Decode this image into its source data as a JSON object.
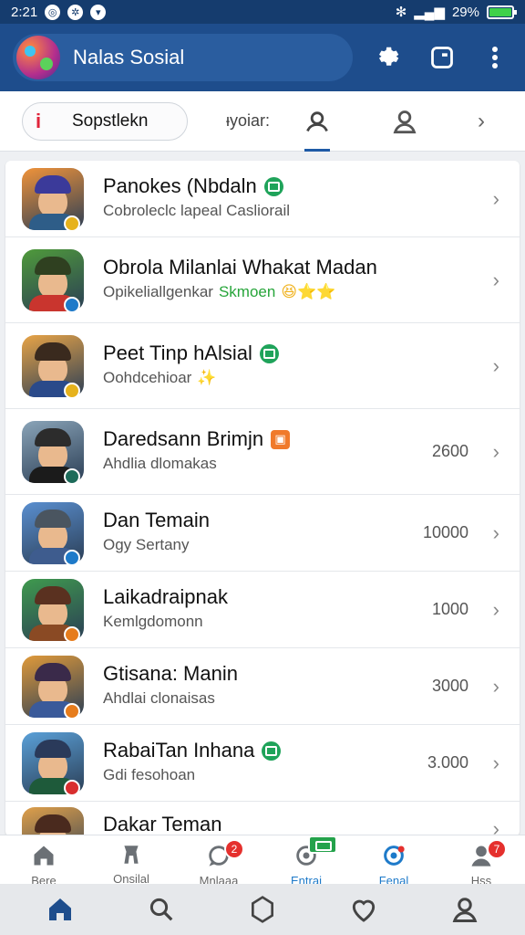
{
  "status_bar": {
    "time": "2:21",
    "left_icons": [
      "app-icon",
      "pinwheel-icon",
      "shield-icon"
    ],
    "battery": "29%"
  },
  "header": {
    "title": "Nalas Sosial",
    "icons": [
      "gear-icon",
      "square-icon",
      "more-icon"
    ]
  },
  "tabs": {
    "search_mark": "i",
    "search_label": "Sopstlekn",
    "text_tab": "ᵻyoiar:",
    "icons": [
      "person-icon",
      "person-icon"
    ]
  },
  "list": [
    {
      "title": "Panokes (Nbdaln",
      "subtitle": "Cobroleclc lapeal Casliorail",
      "count": "",
      "verified": true,
      "tag": false,
      "badge_color": "#e6b21c",
      "hat": "#3b3a9a",
      "body": "#2e5d88",
      "bg": "#f0933a"
    },
    {
      "title": "Obrola Milanlai Whakat Madan",
      "subtitle": "Opikeliallgenkar",
      "subtitle_green": "Skmoen",
      "emoji": "😆⭐⭐",
      "count": "",
      "verified": false,
      "tag": false,
      "badge_color": "#1e7ac9",
      "hat": "#2f4020",
      "body": "#c9352e",
      "bg": "#4f9a3b"
    },
    {
      "title": "Peet Tinp hAlsial",
      "subtitle": "Oohdcehioar",
      "emoji": "✨",
      "count": "",
      "verified": true,
      "tag": false,
      "badge_color": "#e6b21c",
      "hat": "#3a2a1e",
      "body": "#2a4a8a",
      "bg": "#e8a447"
    },
    {
      "title": "Daredsann Brimjn",
      "subtitle": "Ahdlia dlomakas",
      "count": "2600",
      "verified": false,
      "tag": true,
      "badge_color": "#1d6b5a",
      "hat": "#2c2c2c",
      "body": "#1b1b1b",
      "bg": "#8aa4b8"
    },
    {
      "title": "Dan Temain",
      "subtitle": "Ogy Sertany",
      "count": "10000",
      "verified": false,
      "tag": false,
      "badge_color": "#1e7ac9",
      "hat": "#4a5560",
      "body": "#3e5c8e",
      "bg": "#5a8fd0"
    },
    {
      "title": "Laikadraipnak",
      "subtitle": "Kemlgdomonn",
      "count": "1000",
      "verified": false,
      "tag": false,
      "badge_color": "#e67c1c",
      "hat": "#5a3120",
      "body": "#8a4a24",
      "bg": "#3f9a4e"
    },
    {
      "title": "Gtisana: Manin",
      "subtitle": "Ahdlai clonaisas",
      "count": "3000",
      "verified": false,
      "tag": false,
      "badge_color": "#e67c1c",
      "hat": "#3a2a4a",
      "body": "#3a5a9a",
      "bg": "#e09a3a"
    },
    {
      "title": "RabaiTan Inhana",
      "subtitle": "Gdi fesohoan",
      "count": "3.000",
      "verified": true,
      "tag": false,
      "badge_color": "#d82e2e",
      "hat": "#2a3a5a",
      "body": "#1e5a3a",
      "bg": "#5aa0d8"
    },
    {
      "title": "Dakar Teman",
      "subtitle": "",
      "count": "",
      "verified": false,
      "tag": false,
      "badge_color": "",
      "hat": "#4a2a1e",
      "body": "#7a3a24",
      "bg": "#e0a04a"
    }
  ],
  "bottom_nav": [
    {
      "label": "Bere",
      "icon": "home-icon",
      "badge": ""
    },
    {
      "label": "Onsilal",
      "icon": "trophy-icon",
      "badge": ""
    },
    {
      "label": "Mnlaaa",
      "icon": "chat-icon",
      "badge": "2"
    },
    {
      "label": "Entrai",
      "icon": "message-icon",
      "badge": "green"
    },
    {
      "label": "Fenal",
      "icon": "profile-circle-icon",
      "badge": ""
    },
    {
      "label": "Hss",
      "icon": "person-icon",
      "badge": "7"
    }
  ],
  "system_nav": [
    "home-icon",
    "search-icon",
    "circle-icon",
    "heart-icon",
    "profile-icon"
  ]
}
